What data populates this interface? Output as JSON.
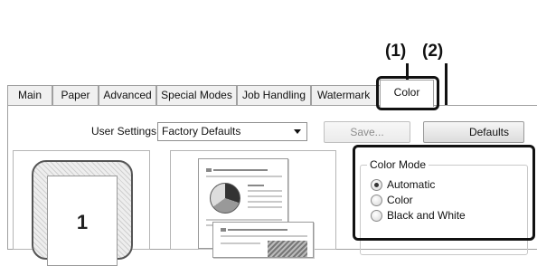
{
  "callouts": {
    "one": "(1)",
    "two": "(2)"
  },
  "tabs": [
    {
      "label": "Main"
    },
    {
      "label": "Paper"
    },
    {
      "label": "Advanced"
    },
    {
      "label": "Special Modes"
    },
    {
      "label": "Job Handling"
    },
    {
      "label": "Watermark"
    },
    {
      "label": "Color"
    }
  ],
  "user_settings": {
    "label": "User Settings:",
    "value": "Factory Defaults",
    "save_label": "Save...",
    "defaults_label": "Defaults"
  },
  "preview": {
    "sheet_number": "1"
  },
  "color_mode": {
    "title": "Color Mode",
    "options": [
      {
        "label": "Automatic",
        "checked": true
      },
      {
        "label": "Color",
        "checked": false
      },
      {
        "label": "Black and White",
        "checked": false
      }
    ]
  }
}
